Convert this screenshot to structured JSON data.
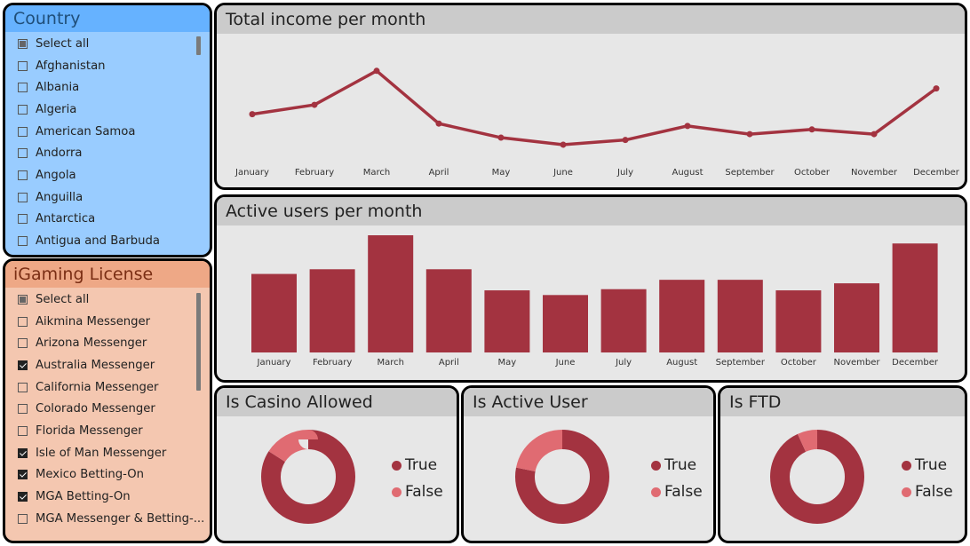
{
  "country_slicer": {
    "title": "Country",
    "items": [
      {
        "label": "Select all",
        "state": "partial"
      },
      {
        "label": "Afghanistan",
        "state": "unchecked"
      },
      {
        "label": "Albania",
        "state": "unchecked"
      },
      {
        "label": "Algeria",
        "state": "unchecked"
      },
      {
        "label": "American Samoa",
        "state": "unchecked"
      },
      {
        "label": "Andorra",
        "state": "unchecked"
      },
      {
        "label": "Angola",
        "state": "unchecked"
      },
      {
        "label": "Anguilla",
        "state": "unchecked"
      },
      {
        "label": "Antarctica",
        "state": "unchecked"
      },
      {
        "label": "Antigua and Barbuda",
        "state": "unchecked"
      }
    ]
  },
  "license_slicer": {
    "title": "iGaming License",
    "items": [
      {
        "label": "Select all",
        "state": "partial"
      },
      {
        "label": "Aikmina Messenger",
        "state": "unchecked"
      },
      {
        "label": "Arizona Messenger",
        "state": "unchecked"
      },
      {
        "label": "Australia Messenger",
        "state": "checked"
      },
      {
        "label": "California Messenger",
        "state": "unchecked"
      },
      {
        "label": "Colorado Messenger",
        "state": "unchecked"
      },
      {
        "label": "Florida Messenger",
        "state": "unchecked"
      },
      {
        "label": "Isle of Man Messenger",
        "state": "checked"
      },
      {
        "label": "Mexico Betting-On",
        "state": "checked"
      },
      {
        "label": "MGA Betting-On",
        "state": "checked"
      },
      {
        "label": "MGA Messenger & Betting-...",
        "state": "unchecked"
      }
    ]
  },
  "colors": {
    "country_bg": "#99ccff",
    "country_title_bg": "#66b2ff",
    "country_title_text": "#1f4e79",
    "license_bg": "#f4c7b0",
    "license_title_bg": "#eea886",
    "license_title_text": "#7a2e14",
    "series": "#a33340",
    "false_color": "#e06b72"
  },
  "income_card": {
    "title": "Total income per month"
  },
  "users_card": {
    "title": "Active users per month"
  },
  "casino_card": {
    "title": "Is Casino Allowed"
  },
  "active_card": {
    "title": "Is Active User"
  },
  "ftd_card": {
    "title": "Is FTD"
  },
  "chart_data": [
    {
      "type": "line",
      "title": "Total income per month",
      "categories": [
        "January",
        "February",
        "March",
        "April",
        "May",
        "June",
        "July",
        "August",
        "September",
        "October",
        "November",
        "December"
      ],
      "values": [
        48,
        56,
        85,
        40,
        28,
        22,
        26,
        38,
        31,
        35,
        31,
        70
      ],
      "ylim": [
        0,
        100
      ],
      "grid": false,
      "legend": "none"
    },
    {
      "type": "bar",
      "title": "Active users per month",
      "categories": [
        "January",
        "February",
        "March",
        "April",
        "May",
        "June",
        "July",
        "August",
        "September",
        "October",
        "November",
        "December"
      ],
      "values": [
        67,
        71,
        100,
        71,
        53,
        49,
        54,
        62,
        62,
        53,
        59,
        93
      ],
      "ylim": [
        0,
        100
      ],
      "grid": false,
      "legend": "none"
    },
    {
      "type": "pie",
      "title": "Is Casino Allowed",
      "categories": [
        "True",
        "False"
      ],
      "values": [
        84,
        16
      ],
      "donut": true,
      "legend": "right"
    },
    {
      "type": "pie",
      "title": "Is Active User",
      "categories": [
        "True",
        "False"
      ],
      "values": [
        78,
        22
      ],
      "donut": true,
      "legend": "right"
    },
    {
      "type": "pie",
      "title": "Is FTD",
      "categories": [
        "True",
        "False"
      ],
      "values": [
        93,
        7
      ],
      "donut": true,
      "legend": "right"
    }
  ]
}
